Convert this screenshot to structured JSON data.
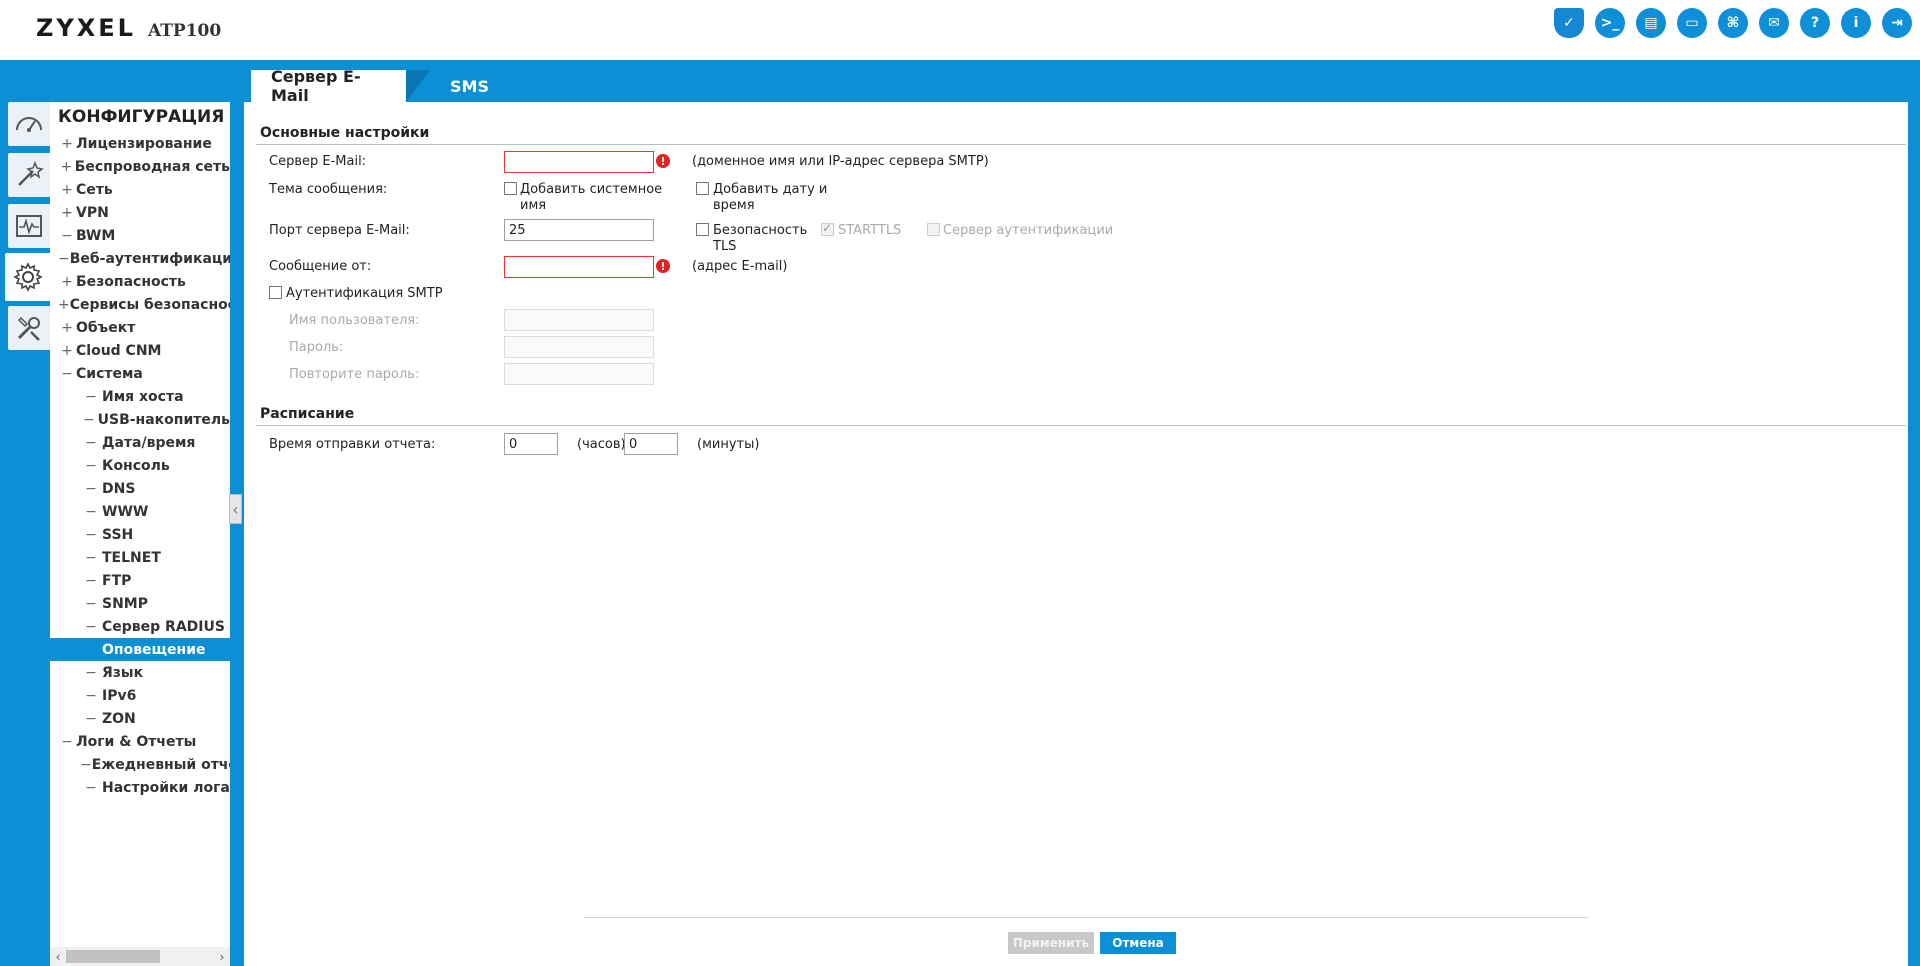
{
  "header": {
    "logo": "ZYXEL",
    "model": "ATP100",
    "toolbar_icons": [
      "shield-icon",
      "console-icon",
      "cli-icon",
      "window-icon",
      "sitemap-icon",
      "chat-icon",
      "help-icon",
      "info-icon",
      "logout-icon"
    ],
    "toolbar_glyphs": [
      "✓",
      ">_",
      "▤",
      "▭",
      "⌘",
      "✉",
      "?",
      "i",
      "⇥"
    ]
  },
  "tabs": [
    {
      "label": "Сервер E-Mail",
      "active": true
    },
    {
      "label": "SMS",
      "active": false
    }
  ],
  "nav": {
    "title": "КОНФИГУРАЦИЯ",
    "items": [
      {
        "sign": "+",
        "label": "Лицензирование",
        "level": 1
      },
      {
        "sign": "+",
        "label": "Беспроводная сеть",
        "level": 1
      },
      {
        "sign": "+",
        "label": "Сеть",
        "level": 1
      },
      {
        "sign": "+",
        "label": "VPN",
        "level": 1
      },
      {
        "sign": "−",
        "label": "BWM",
        "level": 1
      },
      {
        "sign": "−",
        "label": "Веб-аутентификация",
        "level": 1
      },
      {
        "sign": "+",
        "label": "Безопасность",
        "level": 1
      },
      {
        "sign": "+",
        "label": "Сервисы безопасности",
        "level": 1
      },
      {
        "sign": "+",
        "label": "Объект",
        "level": 1
      },
      {
        "sign": "+",
        "label": "Cloud CNM",
        "level": 1
      },
      {
        "sign": "−",
        "label": "Система",
        "level": 1
      },
      {
        "sign": "−",
        "label": "Имя хоста",
        "level": 2
      },
      {
        "sign": "−",
        "label": "USB-накопитель",
        "level": 2
      },
      {
        "sign": "−",
        "label": "Дата/время",
        "level": 2
      },
      {
        "sign": "−",
        "label": "Консоль",
        "level": 2
      },
      {
        "sign": "−",
        "label": "DNS",
        "level": 2
      },
      {
        "sign": "−",
        "label": "WWW",
        "level": 2
      },
      {
        "sign": "−",
        "label": "SSH",
        "level": 2
      },
      {
        "sign": "−",
        "label": "TELNET",
        "level": 2
      },
      {
        "sign": "−",
        "label": "FTP",
        "level": 2
      },
      {
        "sign": "−",
        "label": "SNMP",
        "level": 2
      },
      {
        "sign": "−",
        "label": "Сервер RADIUS",
        "level": 2
      },
      {
        "sign": "−",
        "label": "Оповещение",
        "level": 2,
        "selected": true
      },
      {
        "sign": "−",
        "label": "Язык",
        "level": 2
      },
      {
        "sign": "−",
        "label": "IPv6",
        "level": 2
      },
      {
        "sign": "−",
        "label": "ZON",
        "level": 2
      },
      {
        "sign": "−",
        "label": "Логи & Отчеты",
        "level": 1
      },
      {
        "sign": "−",
        "label": "Ежедневный отчет",
        "level": 2
      },
      {
        "sign": "−",
        "label": "Настройки лога",
        "level": 2
      }
    ]
  },
  "form": {
    "section_basic": "Основные настройки",
    "email_server_label": "Сервер E-Mail:",
    "email_server_value": "",
    "email_server_hint": "(доменное имя или IP-адрес сервера SMTP)",
    "subject_label": "Тема сообщения:",
    "add_system_name_line1": "Добавить системное",
    "add_system_name_line2": "имя",
    "add_datetime_line1": "Добавить дату и",
    "add_datetime_line2": "время",
    "port_label": "Порт сервера E-Mail:",
    "port_value": "25",
    "tls_line1": "Безопасность",
    "tls_line2": "TLS",
    "starttls": "STARTTLS",
    "auth_server": "Сервер аутентификации",
    "from_label": "Сообщение от:",
    "from_value": "",
    "from_hint": "(адрес E-mail)",
    "smtp_auth": "Аутентификация SMTP",
    "username_label": "Имя пользователя:",
    "password_label": "Пароль:",
    "repeat_password_label": "Повторите пароль:",
    "error_glyph": "!",
    "section_schedule": "Расписание",
    "report_time_label": "Время отправки отчета:",
    "hours_value": "0",
    "hours_unit": "(часов)",
    "minutes_value": "0",
    "minutes_unit": "(минуты)"
  },
  "buttons": {
    "apply": "Применить",
    "cancel": "Отмена"
  },
  "colors": {
    "brand_blue": "#0d8fd6",
    "error_red": "#e52222"
  }
}
